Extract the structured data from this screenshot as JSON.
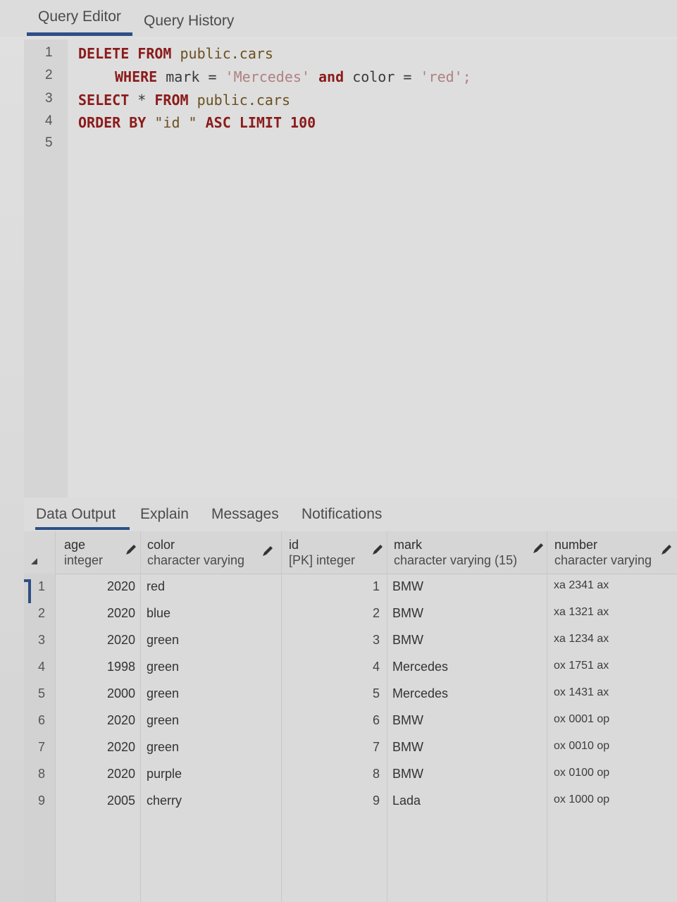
{
  "editor_tabs": [
    "Query Editor",
    "Query History"
  ],
  "line_numbers": [
    "1",
    "2",
    "3",
    "4",
    "5"
  ],
  "sql": {
    "line1": {
      "delete": "DELETE",
      "from": "FROM",
      "table": "public.cars"
    },
    "line2": {
      "where": "WHERE",
      "rest": " mark = ",
      "v1": "'Mercedes'",
      "and": " and ",
      "col": "color = ",
      "v2": "'red';"
    },
    "line3": {
      "select": "SELECT",
      "star": " * ",
      "from": "FROM",
      "table": " public.cars"
    },
    "line4": {
      "order": "ORDER BY",
      "col": " \"id \" ",
      "asc": "ASC LIMIT",
      "limit": " 100"
    }
  },
  "panel_tabs": [
    "Data Output",
    "Explain",
    "Messages",
    "Notifications"
  ],
  "columns": [
    {
      "name": "age",
      "type": "integer"
    },
    {
      "name": "color",
      "type": "character varying"
    },
    {
      "name": "id",
      "type": "[PK] integer"
    },
    {
      "name": "mark",
      "type": "character varying (15)"
    },
    {
      "name": "number",
      "type": "character varying"
    }
  ],
  "rows": [
    {
      "rn": "1",
      "age": "2020",
      "color": "red",
      "id": "1",
      "mark": "BMW",
      "number": "xa 2341 ax"
    },
    {
      "rn": "2",
      "age": "2020",
      "color": "blue",
      "id": "2",
      "mark": "BMW",
      "number": "xa 1321 ax"
    },
    {
      "rn": "3",
      "age": "2020",
      "color": "green",
      "id": "3",
      "mark": "BMW",
      "number": "xa 1234 ax"
    },
    {
      "rn": "4",
      "age": "1998",
      "color": "green",
      "id": "4",
      "mark": "Mercedes",
      "number": "ox 1751 ax"
    },
    {
      "rn": "5",
      "age": "2000",
      "color": "green",
      "id": "5",
      "mark": "Mercedes",
      "number": "ox 1431 ax"
    },
    {
      "rn": "6",
      "age": "2020",
      "color": "green",
      "id": "6",
      "mark": "BMW",
      "number": "ox 0001 op"
    },
    {
      "rn": "7",
      "age": "2020",
      "color": "green",
      "id": "7",
      "mark": "BMW",
      "number": "ox 0010 op"
    },
    {
      "rn": "8",
      "age": "2020",
      "color": "purple",
      "id": "8",
      "mark": "BMW",
      "number": "ox 0100 op"
    },
    {
      "rn": "9",
      "age": "2005",
      "color": "cherry",
      "id": "9",
      "mark": "Lada",
      "number": "ox 1000 op"
    }
  ],
  "icons": {
    "edit": "pencil-icon",
    "sort": "sort-ascending-icon"
  },
  "colors": {
    "accent": "#2e4f86",
    "keyword": "#8b1a1a"
  }
}
